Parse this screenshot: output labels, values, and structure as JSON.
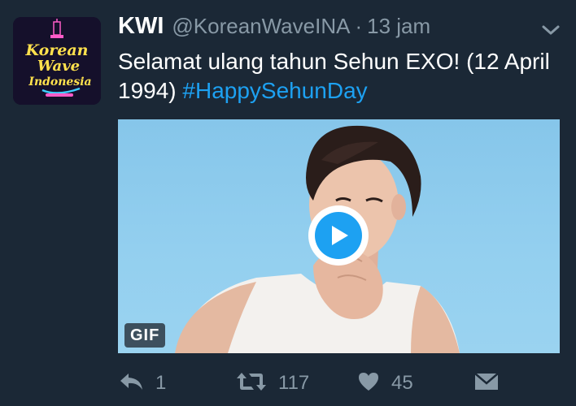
{
  "tweet": {
    "display_name": "KWI",
    "handle": "@KoreanWaveINA",
    "separator": "·",
    "time": "13 jam",
    "text": "Selamat ulang tahun Sehun EXO! (12 April 1994) ",
    "hashtag": "#HappySehunDay",
    "media_badge": "GIF"
  },
  "avatar": {
    "logo_lines": [
      "Korean",
      "Wave",
      "Indonesia"
    ]
  },
  "actions": {
    "reply_count": "1",
    "retweet_count": "117",
    "like_count": "45"
  },
  "colors": {
    "background": "#1b2836",
    "text": "#ffffff",
    "muted": "#8899a6",
    "accent": "#1da1f2"
  },
  "icons": [
    "reply-icon",
    "retweet-icon",
    "like-icon",
    "dm-icon",
    "chevron-down-icon",
    "play-icon"
  ]
}
